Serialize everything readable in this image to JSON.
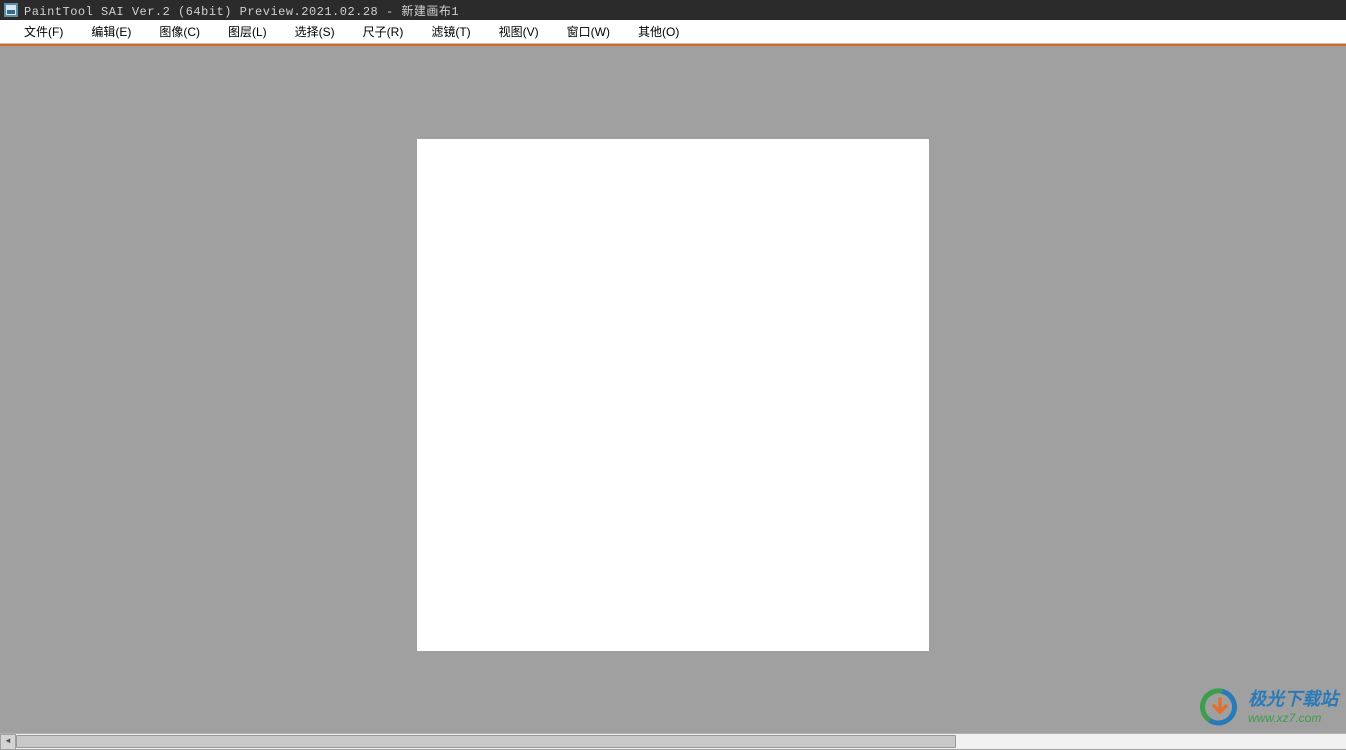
{
  "title": "PaintTool SAI Ver.2 (64bit) Preview.2021.02.28 - 新建画布1",
  "menu": {
    "file": "文件(F)",
    "edit": "编辑(E)",
    "image": "图像(C)",
    "layer": "图层(L)",
    "select": "选择(S)",
    "ruler": "尺子(R)",
    "filter": "滤镜(T)",
    "view": "视图(V)",
    "window": "窗口(W)",
    "other": "其他(O)"
  },
  "watermark": {
    "cn": "极光下载站",
    "url": "www.xz7.com"
  }
}
